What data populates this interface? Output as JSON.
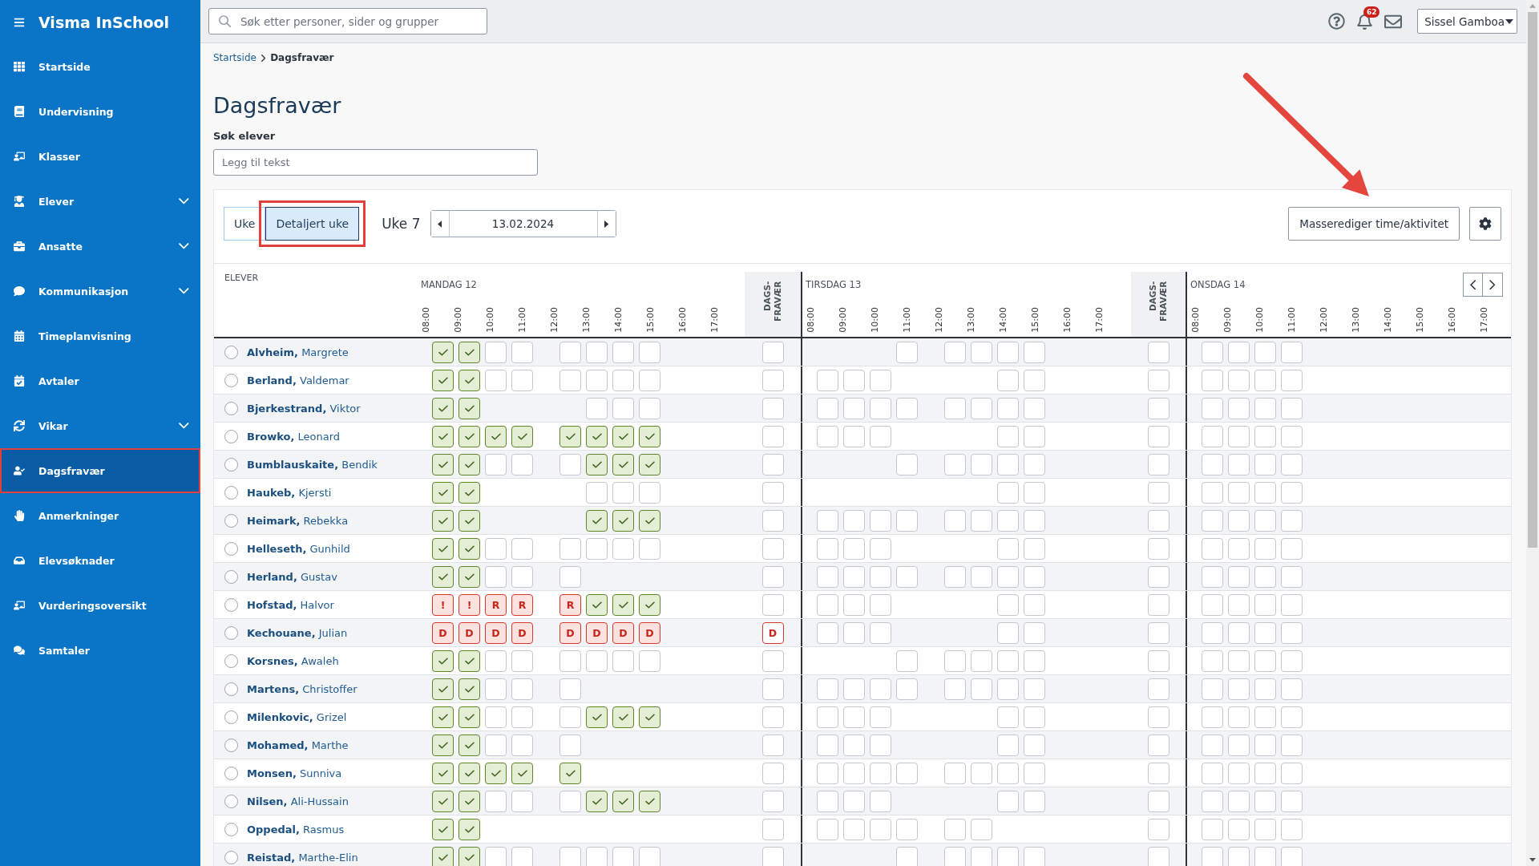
{
  "app": {
    "title": "Visma InSchool"
  },
  "sidebar": {
    "items": [
      {
        "label": "Startside",
        "kind": "link",
        "selected": false,
        "highlighted": false
      },
      {
        "label": "Undervisning",
        "kind": "link",
        "selected": false,
        "highlighted": false
      },
      {
        "label": "Klasser",
        "kind": "link",
        "selected": false,
        "highlighted": false
      },
      {
        "label": "Elever",
        "kind": "group",
        "expanded": false,
        "selected": false,
        "highlighted": false
      },
      {
        "label": "Ansatte",
        "kind": "group",
        "expanded": false,
        "selected": false,
        "highlighted": false
      },
      {
        "label": "Kommunikasjon",
        "kind": "group",
        "expanded": false,
        "selected": false,
        "highlighted": false
      },
      {
        "label": "Timeplanvisning",
        "kind": "link",
        "selected": false,
        "highlighted": false
      },
      {
        "label": "Avtaler",
        "kind": "link",
        "selected": false,
        "highlighted": false
      },
      {
        "label": "Vikar",
        "kind": "group",
        "expanded": false,
        "selected": false,
        "highlighted": false
      },
      {
        "label": "Dagsfravær",
        "kind": "link",
        "selected": true,
        "highlighted": true
      },
      {
        "label": "Anmerkninger",
        "kind": "link",
        "selected": false,
        "highlighted": false
      },
      {
        "label": "Elevsøknader",
        "kind": "link",
        "selected": false,
        "highlighted": false
      },
      {
        "label": "Vurderingsoversikt",
        "kind": "link",
        "selected": false,
        "highlighted": false
      },
      {
        "label": "Samtaler",
        "kind": "link",
        "selected": false,
        "highlighted": false
      }
    ]
  },
  "topbar": {
    "search": {
      "placeholder": "Søk etter personer, sider og grupper"
    },
    "notifications": {
      "count": "62"
    },
    "user": {
      "name": "Sissel Gamboa"
    }
  },
  "breadcrumb": [
    {
      "label": "Startside",
      "kind": "link"
    },
    {
      "label": "Dagsfravær",
      "kind": "current"
    }
  ],
  "page": {
    "title": "Dagsfravær",
    "student_search": {
      "label": "Søk elever",
      "placeholder": "Legg til tekst"
    }
  },
  "toolbar": {
    "views": [
      {
        "label": "Uke",
        "selected": false,
        "highlighted": false
      },
      {
        "label": "Detaljert uke",
        "selected": true,
        "highlighted": true
      }
    ],
    "week": "Uke 7",
    "date": "13.02.2024",
    "bulk_edit_button": "Masserediger time/aktivitet"
  },
  "table": {
    "student_column": "ELEVER",
    "days": [
      {
        "title": "MANDAG 12",
        "hours": [
          "08:00",
          "09:00",
          "10:00",
          "11:00",
          "12:00",
          "13:00",
          "14:00",
          "15:00",
          "16:00",
          "17:00"
        ],
        "day_absence_header": "DAGS-FRAVÆR"
      },
      {
        "title": "TIRSDAG 13",
        "hours": [
          "08:00",
          "09:00",
          "10:00",
          "11:00",
          "12:00",
          "13:00",
          "14:00",
          "15:00",
          "16:00",
          "17:00"
        ],
        "day_absence_header": "DAGS-FRAVÆR"
      },
      {
        "title": "ONSDAG 14",
        "hours": [
          "08:00",
          "09:00",
          "10:00",
          "11:00",
          "12:00",
          "13:00",
          "14:00",
          "15:00",
          "16:00",
          "17:00"
        ]
      }
    ],
    "rows": [
      {
        "name": "**Alvheim,** Margrete",
        "checked": false,
        "days": [
          {
            "slots": [
              {
                "kind": "present"
              },
              {
                "kind": "present"
              },
              {
                "kind": "open"
              },
              {
                "kind": "open"
              },
              {
                "kind": "open"
              },
              {
                "kind": "open"
              },
              {
                "kind": "open"
              },
              {
                "kind": "open"
              }
            ],
            "day_absence": {
              "kind": "open"
            }
          },
          {
            "slots": [
              {
                "kind": "none"
              },
              {
                "kind": "none"
              },
              {
                "kind": "none"
              },
              {
                "kind": "open"
              },
              {
                "kind": "open"
              },
              {
                "kind": "open"
              },
              {
                "kind": "open"
              },
              {
                "kind": "open"
              }
            ],
            "day_absence": {
              "kind": "open"
            }
          },
          {
            "slots": [
              {
                "kind": "open"
              },
              {
                "kind": "open"
              },
              {
                "kind": "open"
              },
              {
                "kind": "open"
              }
            ]
          }
        ]
      },
      {
        "name": "**Berland,** Valdemar",
        "checked": false,
        "days": [
          {
            "slots": [
              {
                "kind": "present"
              },
              {
                "kind": "present"
              },
              {
                "kind": "open"
              },
              {
                "kind": "open"
              },
              {
                "kind": "open"
              },
              {
                "kind": "open"
              },
              {
                "kind": "open"
              },
              {
                "kind": "open"
              }
            ],
            "day_absence": {
              "kind": "open"
            }
          },
          {
            "slots": [
              {
                "kind": "open"
              },
              {
                "kind": "open"
              },
              {
                "kind": "open"
              },
              {
                "kind": "none"
              },
              {
                "kind": "none"
              },
              {
                "kind": "none"
              },
              {
                "kind": "open"
              },
              {
                "kind": "open"
              }
            ],
            "day_absence": {
              "kind": "open"
            }
          },
          {
            "slots": [
              {
                "kind": "open"
              },
              {
                "kind": "open"
              },
              {
                "kind": "open"
              },
              {
                "kind": "open"
              }
            ]
          }
        ]
      },
      {
        "name": "**Bjerkestrand,** Viktor",
        "checked": false,
        "days": [
          {
            "slots": [
              {
                "kind": "present"
              },
              {
                "kind": "present"
              },
              {
                "kind": "none"
              },
              {
                "kind": "none"
              },
              {
                "kind": "none"
              },
              {
                "kind": "open"
              },
              {
                "kind": "open"
              },
              {
                "kind": "open"
              }
            ],
            "day_absence": {
              "kind": "open"
            }
          },
          {
            "slots": [
              {
                "kind": "open"
              },
              {
                "kind": "open"
              },
              {
                "kind": "open"
              },
              {
                "kind": "open"
              },
              {
                "kind": "open"
              },
              {
                "kind": "open"
              },
              {
                "kind": "open"
              },
              {
                "kind": "open"
              }
            ],
            "day_absence": {
              "kind": "open"
            }
          },
          {
            "slots": [
              {
                "kind": "open"
              },
              {
                "kind": "open"
              },
              {
                "kind": "open"
              },
              {
                "kind": "open"
              }
            ]
          }
        ]
      },
      {
        "name": "**Browko,** Leonard",
        "checked": false,
        "days": [
          {
            "slots": [
              {
                "kind": "present"
              },
              {
                "kind": "present"
              },
              {
                "kind": "present"
              },
              {
                "kind": "present"
              },
              {
                "kind": "present"
              },
              {
                "kind": "present"
              },
              {
                "kind": "present"
              },
              {
                "kind": "present"
              }
            ],
            "day_absence": {
              "kind": "open"
            }
          },
          {
            "slots": [
              {
                "kind": "open"
              },
              {
                "kind": "open"
              },
              {
                "kind": "open"
              },
              {
                "kind": "none"
              },
              {
                "kind": "none"
              },
              {
                "kind": "none"
              },
              {
                "kind": "open"
              },
              {
                "kind": "open"
              }
            ],
            "day_absence": {
              "kind": "open"
            }
          },
          {
            "slots": [
              {
                "kind": "open"
              },
              {
                "kind": "open"
              },
              {
                "kind": "open"
              },
              {
                "kind": "open"
              }
            ]
          }
        ]
      },
      {
        "name": "**Bumblauskaite,** Bendik",
        "checked": false,
        "days": [
          {
            "slots": [
              {
                "kind": "present"
              },
              {
                "kind": "present"
              },
              {
                "kind": "open"
              },
              {
                "kind": "open"
              },
              {
                "kind": "open"
              },
              {
                "kind": "present"
              },
              {
                "kind": "present"
              },
              {
                "kind": "present"
              }
            ],
            "day_absence": {
              "kind": "open"
            }
          },
          {
            "slots": [
              {
                "kind": "none"
              },
              {
                "kind": "none"
              },
              {
                "kind": "none"
              },
              {
                "kind": "open"
              },
              {
                "kind": "open"
              },
              {
                "kind": "open"
              },
              {
                "kind": "open"
              },
              {
                "kind": "open"
              }
            ],
            "day_absence": {
              "kind": "open"
            }
          },
          {
            "slots": [
              {
                "kind": "open"
              },
              {
                "kind": "open"
              },
              {
                "kind": "open"
              },
              {
                "kind": "open"
              }
            ]
          }
        ]
      },
      {
        "name": "**Haukeb,** Kjersti",
        "checked": false,
        "days": [
          {
            "slots": [
              {
                "kind": "present"
              },
              {
                "kind": "present"
              },
              {
                "kind": "none"
              },
              {
                "kind": "none"
              },
              {
                "kind": "none"
              },
              {
                "kind": "open"
              },
              {
                "kind": "open"
              },
              {
                "kind": "open"
              }
            ],
            "day_absence": {
              "kind": "open"
            }
          },
          {
            "slots": [
              {
                "kind": "none"
              },
              {
                "kind": "none"
              },
              {
                "kind": "none"
              },
              {
                "kind": "none"
              },
              {
                "kind": "none"
              },
              {
                "kind": "none"
              },
              {
                "kind": "open"
              },
              {
                "kind": "open"
              }
            ],
            "day_absence": {
              "kind": "open"
            }
          },
          {
            "slots": [
              {
                "kind": "open"
              },
              {
                "kind": "open"
              },
              {
                "kind": "open"
              },
              {
                "kind": "open"
              }
            ]
          }
        ]
      },
      {
        "name": "**Heimark,** Rebekka",
        "checked": false,
        "days": [
          {
            "slots": [
              {
                "kind": "present"
              },
              {
                "kind": "present"
              },
              {
                "kind": "none"
              },
              {
                "kind": "none"
              },
              {
                "kind": "none"
              },
              {
                "kind": "present"
              },
              {
                "kind": "present"
              },
              {
                "kind": "present"
              }
            ],
            "day_absence": {
              "kind": "open"
            }
          },
          {
            "slots": [
              {
                "kind": "open"
              },
              {
                "kind": "open"
              },
              {
                "kind": "open"
              },
              {
                "kind": "open"
              },
              {
                "kind": "open"
              },
              {
                "kind": "open"
              },
              {
                "kind": "open"
              },
              {
                "kind": "open"
              }
            ],
            "day_absence": {
              "kind": "open"
            }
          },
          {
            "slots": [
              {
                "kind": "open"
              },
              {
                "kind": "open"
              },
              {
                "kind": "open"
              },
              {
                "kind": "open"
              }
            ]
          }
        ]
      },
      {
        "name": "**Helleseth,** Gunhild",
        "checked": false,
        "days": [
          {
            "slots": [
              {
                "kind": "present"
              },
              {
                "kind": "present"
              },
              {
                "kind": "open"
              },
              {
                "kind": "open"
              },
              {
                "kind": "open"
              },
              {
                "kind": "open"
              },
              {
                "kind": "open"
              },
              {
                "kind": "open"
              }
            ],
            "day_absence": {
              "kind": "open"
            }
          },
          {
            "slots": [
              {
                "kind": "open"
              },
              {
                "kind": "open"
              },
              {
                "kind": "open"
              },
              {
                "kind": "none"
              },
              {
                "kind": "none"
              },
              {
                "kind": "none"
              },
              {
                "kind": "open"
              },
              {
                "kind": "open"
              }
            ],
            "day_absence": {
              "kind": "open"
            }
          },
          {
            "slots": [
              {
                "kind": "open"
              },
              {
                "kind": "open"
              },
              {
                "kind": "open"
              },
              {
                "kind": "open"
              }
            ]
          }
        ]
      },
      {
        "name": "**Herland,** Gustav",
        "checked": false,
        "days": [
          {
            "slots": [
              {
                "kind": "present"
              },
              {
                "kind": "present"
              },
              {
                "kind": "open"
              },
              {
                "kind": "open"
              },
              {
                "kind": "open"
              }
            ],
            "day_absence": {
              "kind": "open"
            }
          },
          {
            "slots": [
              {
                "kind": "open"
              },
              {
                "kind": "open"
              },
              {
                "kind": "open"
              },
              {
                "kind": "open"
              },
              {
                "kind": "open"
              },
              {
                "kind": "open"
              },
              {
                "kind": "open"
              },
              {
                "kind": "open"
              }
            ],
            "day_absence": {
              "kind": "open"
            }
          },
          {
            "slots": [
              {
                "kind": "open"
              },
              {
                "kind": "open"
              },
              {
                "kind": "open"
              },
              {
                "kind": "open"
              }
            ]
          }
        ]
      },
      {
        "name": "**Hofstad,** Halvor",
        "checked": false,
        "days": [
          {
            "slots": [
              {
                "kind": "code",
                "code": "!"
              },
              {
                "kind": "code",
                "code": "!"
              },
              {
                "kind": "code",
                "code": "R"
              },
              {
                "kind": "code",
                "code": "R"
              },
              {
                "kind": "code",
                "code": "R"
              },
              {
                "kind": "present"
              },
              {
                "kind": "present"
              },
              {
                "kind": "present"
              }
            ],
            "day_absence": {
              "kind": "open"
            }
          },
          {
            "slots": [
              {
                "kind": "open"
              },
              {
                "kind": "open"
              },
              {
                "kind": "open"
              },
              {
                "kind": "none"
              },
              {
                "kind": "none"
              },
              {
                "kind": "none"
              },
              {
                "kind": "open"
              },
              {
                "kind": "open"
              }
            ],
            "day_absence": {
              "kind": "open"
            }
          },
          {
            "slots": [
              {
                "kind": "open"
              },
              {
                "kind": "open"
              },
              {
                "kind": "open"
              },
              {
                "kind": "open"
              }
            ]
          }
        ]
      },
      {
        "name": "**Kechouane,** Julian",
        "checked": false,
        "days": [
          {
            "slots": [
              {
                "kind": "code",
                "code": "D"
              },
              {
                "kind": "code",
                "code": "D"
              },
              {
                "kind": "code",
                "code": "D"
              },
              {
                "kind": "code",
                "code": "D"
              },
              {
                "kind": "code",
                "code": "D"
              },
              {
                "kind": "code",
                "code": "D"
              },
              {
                "kind": "code",
                "code": "D"
              },
              {
                "kind": "code",
                "code": "D"
              }
            ],
            "day_absence": {
              "kind": "code",
              "code": "D"
            }
          },
          {
            "slots": [
              {
                "kind": "open"
              },
              {
                "kind": "open"
              },
              {
                "kind": "open"
              },
              {
                "kind": "none"
              },
              {
                "kind": "none"
              },
              {
                "kind": "none"
              },
              {
                "kind": "open"
              },
              {
                "kind": "open"
              }
            ],
            "day_absence": {
              "kind": "open"
            }
          },
          {
            "slots": [
              {
                "kind": "open"
              },
              {
                "kind": "open"
              },
              {
                "kind": "open"
              },
              {
                "kind": "open"
              }
            ]
          }
        ]
      },
      {
        "name": "**Korsnes,** Awaleh",
        "checked": false,
        "days": [
          {
            "slots": [
              {
                "kind": "present"
              },
              {
                "kind": "present"
              },
              {
                "kind": "open"
              },
              {
                "kind": "open"
              },
              {
                "kind": "open"
              },
              {
                "kind": "open"
              },
              {
                "kind": "open"
              },
              {
                "kind": "open"
              }
            ],
            "day_absence": {
              "kind": "open"
            }
          },
          {
            "slots": [
              {
                "kind": "none"
              },
              {
                "kind": "none"
              },
              {
                "kind": "none"
              },
              {
                "kind": "open"
              },
              {
                "kind": "open"
              },
              {
                "kind": "open"
              },
              {
                "kind": "open"
              },
              {
                "kind": "open"
              }
            ],
            "day_absence": {
              "kind": "open"
            }
          },
          {
            "slots": [
              {
                "kind": "open"
              },
              {
                "kind": "open"
              },
              {
                "kind": "open"
              },
              {
                "kind": "open"
              }
            ]
          }
        ]
      },
      {
        "name": "**Martens,** Christoffer",
        "checked": false,
        "days": [
          {
            "slots": [
              {
                "kind": "present"
              },
              {
                "kind": "present"
              },
              {
                "kind": "open"
              },
              {
                "kind": "open"
              },
              {
                "kind": "open"
              }
            ],
            "day_absence": {
              "kind": "open"
            }
          },
          {
            "slots": [
              {
                "kind": "open"
              },
              {
                "kind": "open"
              },
              {
                "kind": "open"
              },
              {
                "kind": "open"
              },
              {
                "kind": "open"
              },
              {
                "kind": "open"
              },
              {
                "kind": "open"
              },
              {
                "kind": "open"
              }
            ],
            "day_absence": {
              "kind": "open"
            }
          },
          {
            "slots": [
              {
                "kind": "open"
              },
              {
                "kind": "open"
              },
              {
                "kind": "open"
              },
              {
                "kind": "open"
              }
            ]
          }
        ]
      },
      {
        "name": "**Milenkovic,** Grizel",
        "checked": false,
        "days": [
          {
            "slots": [
              {
                "kind": "present"
              },
              {
                "kind": "present"
              },
              {
                "kind": "open"
              },
              {
                "kind": "open"
              },
              {
                "kind": "open"
              },
              {
                "kind": "present"
              },
              {
                "kind": "present"
              },
              {
                "kind": "present"
              }
            ],
            "day_absence": {
              "kind": "open"
            }
          },
          {
            "slots": [
              {
                "kind": "open"
              },
              {
                "kind": "open"
              },
              {
                "kind": "open"
              },
              {
                "kind": "none"
              },
              {
                "kind": "none"
              },
              {
                "kind": "none"
              },
              {
                "kind": "open"
              },
              {
                "kind": "open"
              }
            ],
            "day_absence": {
              "kind": "open"
            }
          },
          {
            "slots": [
              {
                "kind": "open"
              },
              {
                "kind": "open"
              },
              {
                "kind": "open"
              },
              {
                "kind": "open"
              }
            ]
          }
        ]
      },
      {
        "name": "**Mohamed,** Marthe",
        "checked": false,
        "days": [
          {
            "slots": [
              {
                "kind": "present"
              },
              {
                "kind": "present"
              },
              {
                "kind": "open"
              },
              {
                "kind": "open"
              },
              {
                "kind": "open"
              }
            ],
            "day_absence": {
              "kind": "open"
            }
          },
          {
            "slots": [
              {
                "kind": "open"
              },
              {
                "kind": "open"
              },
              {
                "kind": "open"
              },
              {
                "kind": "none"
              },
              {
                "kind": "none"
              },
              {
                "kind": "none"
              },
              {
                "kind": "open"
              },
              {
                "kind": "open"
              }
            ],
            "day_absence": {
              "kind": "open"
            }
          },
          {
            "slots": [
              {
                "kind": "open"
              },
              {
                "kind": "open"
              },
              {
                "kind": "open"
              },
              {
                "kind": "open"
              }
            ]
          }
        ]
      },
      {
        "name": "**Monsen,** Sunniva",
        "checked": false,
        "days": [
          {
            "slots": [
              {
                "kind": "present"
              },
              {
                "kind": "present"
              },
              {
                "kind": "present"
              },
              {
                "kind": "present"
              },
              {
                "kind": "present"
              }
            ],
            "day_absence": {
              "kind": "open"
            }
          },
          {
            "slots": [
              {
                "kind": "open"
              },
              {
                "kind": "open"
              },
              {
                "kind": "open"
              },
              {
                "kind": "open"
              },
              {
                "kind": "open"
              },
              {
                "kind": "open"
              },
              {
                "kind": "open"
              },
              {
                "kind": "open"
              }
            ],
            "day_absence": {
              "kind": "open"
            }
          },
          {
            "slots": [
              {
                "kind": "open"
              },
              {
                "kind": "open"
              },
              {
                "kind": "open"
              },
              {
                "kind": "open"
              }
            ]
          }
        ]
      },
      {
        "name": "**Nilsen,** Ali-Hussain",
        "checked": false,
        "days": [
          {
            "slots": [
              {
                "kind": "present"
              },
              {
                "kind": "present"
              },
              {
                "kind": "open"
              },
              {
                "kind": "open"
              },
              {
                "kind": "open"
              },
              {
                "kind": "present"
              },
              {
                "kind": "present"
              },
              {
                "kind": "present"
              }
            ],
            "day_absence": {
              "kind": "open"
            }
          },
          {
            "slots": [
              {
                "kind": "open"
              },
              {
                "kind": "open"
              },
              {
                "kind": "open"
              },
              {
                "kind": "none"
              },
              {
                "kind": "none"
              },
              {
                "kind": "none"
              },
              {
                "kind": "open"
              },
              {
                "kind": "open"
              }
            ],
            "day_absence": {
              "kind": "open"
            }
          },
          {
            "slots": [
              {
                "kind": "open"
              },
              {
                "kind": "open"
              },
              {
                "kind": "open"
              },
              {
                "kind": "open"
              }
            ]
          }
        ]
      },
      {
        "name": "**Oppedal,** Rasmus",
        "checked": false,
        "days": [
          {
            "slots": [
              {
                "kind": "present"
              },
              {
                "kind": "present"
              }
            ],
            "day_absence": {
              "kind": "open"
            }
          },
          {
            "slots": [
              {
                "kind": "open"
              },
              {
                "kind": "open"
              },
              {
                "kind": "open"
              },
              {
                "kind": "open"
              },
              {
                "kind": "open"
              },
              {
                "kind": "open"
              }
            ],
            "day_absence": {
              "kind": "open"
            }
          },
          {
            "slots": [
              {
                "kind": "open"
              },
              {
                "kind": "open"
              },
              {
                "kind": "open"
              },
              {
                "kind": "open"
              }
            ]
          }
        ]
      },
      {
        "name": "**Reistad,** Marthe-Elin",
        "checked": false,
        "days": [
          {
            "slots": [
              {
                "kind": "present"
              },
              {
                "kind": "present"
              },
              {
                "kind": "open"
              },
              {
                "kind": "open"
              },
              {
                "kind": "open"
              },
              {
                "kind": "open"
              },
              {
                "kind": "open"
              },
              {
                "kind": "open"
              }
            ],
            "day_absence": {
              "kind": "open"
            }
          },
          {
            "slots": [
              {
                "kind": "none"
              },
              {
                "kind": "none"
              },
              {
                "kind": "none"
              },
              {
                "kind": "open"
              },
              {
                "kind": "open"
              },
              {
                "kind": "open"
              },
              {
                "kind": "open"
              },
              {
                "kind": "open"
              }
            ],
            "day_absence": {
              "kind": "open"
            }
          },
          {
            "slots": [
              {
                "kind": "open"
              },
              {
                "kind": "open"
              },
              {
                "kind": "open"
              },
              {
                "kind": "open"
              }
            ]
          }
        ]
      }
    ]
  },
  "annotations": [
    {
      "kind": "arrow"
    }
  ]
}
